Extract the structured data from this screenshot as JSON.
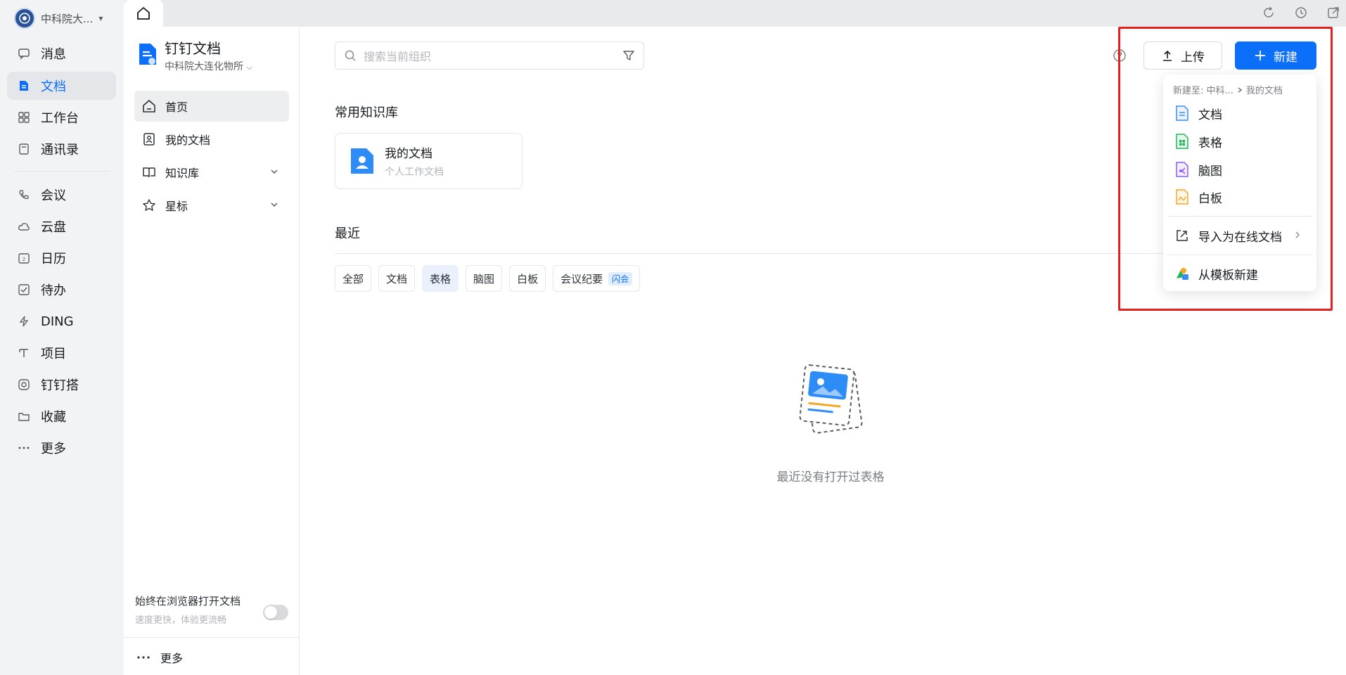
{
  "org": {
    "name": "中科院大...",
    "caret": "▾"
  },
  "rail": {
    "items": [
      {
        "label": "消息",
        "icon": "message-icon"
      },
      {
        "label": "文档",
        "icon": "docs-icon",
        "active": true
      },
      {
        "label": "工作台",
        "icon": "workbench-icon"
      },
      {
        "label": "通讯录",
        "icon": "contacts-icon"
      },
      {
        "label": "会议",
        "icon": "meeting-icon"
      },
      {
        "label": "云盘",
        "icon": "cloud-disk-icon"
      },
      {
        "label": "日历",
        "icon": "calendar-icon"
      },
      {
        "label": "待办",
        "icon": "todo-icon"
      },
      {
        "label": "DING",
        "icon": "ding-icon"
      },
      {
        "label": "项目",
        "icon": "project-icon"
      },
      {
        "label": "钉钉搭",
        "icon": "dingtalk-build-icon"
      },
      {
        "label": "收藏",
        "icon": "favorites-icon"
      },
      {
        "label": "更多",
        "icon": "more-icon"
      }
    ]
  },
  "nav": {
    "title": "钉钉文档",
    "org": "中科院大连化物所",
    "items": [
      {
        "label": "首页",
        "icon": "home-icon",
        "active": true
      },
      {
        "label": "我的文档",
        "icon": "my-docs-icon"
      },
      {
        "label": "知识库",
        "icon": "knowledge-base-icon",
        "expandable": true
      },
      {
        "label": "星标",
        "icon": "star-icon",
        "expandable": true
      }
    ],
    "browser_option": {
      "title": "始终在浏览器打开文档",
      "subtitle": "速度更快，体验更流畅",
      "enabled": false
    },
    "more_label": "更多"
  },
  "main": {
    "search_placeholder": "搜索当前组织",
    "upload_label": "上传",
    "new_label": "新建",
    "frequent_kb_title": "常用知识库",
    "kb_card": {
      "title": "我的文档",
      "subtitle": "个人工作文档"
    },
    "recent_title": "最近",
    "filters": [
      {
        "label": "全部"
      },
      {
        "label": "文档"
      },
      {
        "label": "表格",
        "active": true
      },
      {
        "label": "脑图"
      },
      {
        "label": "白板"
      },
      {
        "label": "会议纪要",
        "badge": "闪会"
      }
    ],
    "empty_text": "最近没有打开过表格"
  },
  "new_menu": {
    "path_prefix": "新建至: 中科...",
    "path_target": "我的文档",
    "items": [
      {
        "label": "文档",
        "icon": "doc-file-icon",
        "color": "#3c8cf5"
      },
      {
        "label": "表格",
        "icon": "sheet-file-icon",
        "color": "#25b35a"
      },
      {
        "label": "脑图",
        "icon": "mindmap-file-icon",
        "color": "#8c5cf0"
      },
      {
        "label": "白板",
        "icon": "whiteboard-file-icon",
        "color": "#f5a623"
      }
    ],
    "import_label": "导入为在线文档",
    "template_label": "从模板新建"
  },
  "colors": {
    "accent": "#0b6ffa",
    "highlight": "#e5201f"
  }
}
